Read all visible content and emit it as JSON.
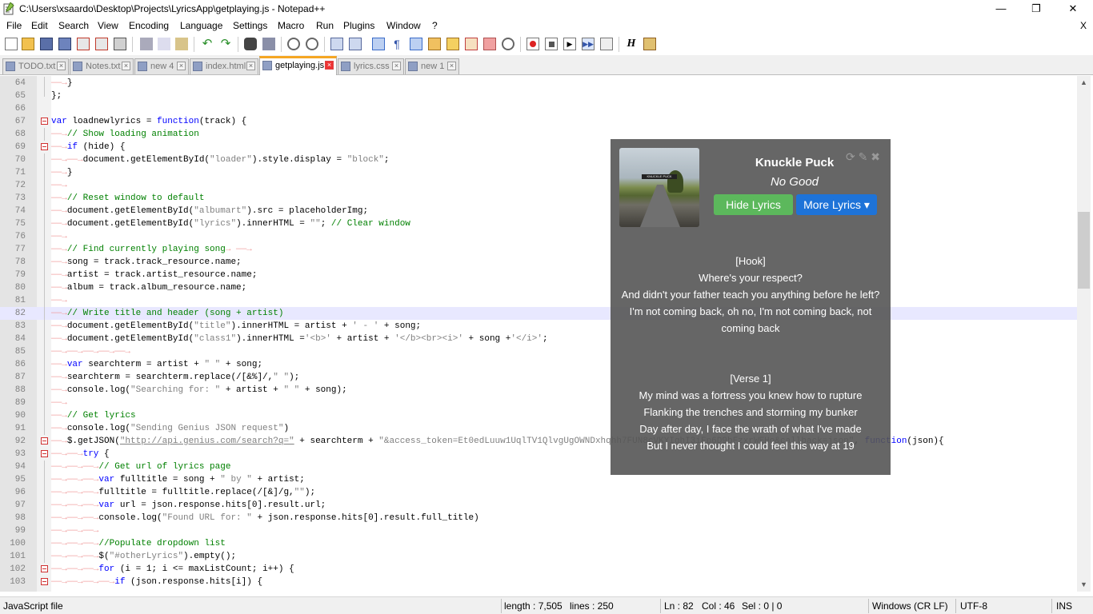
{
  "window": {
    "title": "C:\\Users\\xsaardo\\Desktop\\Projects\\LyricsApp\\getplaying.js - Notepad++",
    "minimize": "—",
    "maximize": "❐",
    "close": "✕"
  },
  "menu": {
    "items": [
      "File",
      "Edit",
      "Search",
      "View",
      "Encoding",
      "Language",
      "Settings",
      "Macro",
      "Run",
      "Plugins",
      "Window",
      "?"
    ],
    "close": "X"
  },
  "tabs": [
    {
      "label": "TODO.txt",
      "active": false
    },
    {
      "label": "Notes.txt",
      "active": false
    },
    {
      "label": "new 4",
      "active": false
    },
    {
      "label": "index.html",
      "active": false
    },
    {
      "label": "getplaying.js",
      "active": true
    },
    {
      "label": "lyrics.css",
      "active": false
    },
    {
      "label": "new 1",
      "active": false
    }
  ],
  "editor": {
    "current_line": 82,
    "lines": [
      {
        "n": "64",
        "fold": "line",
        "html": "<span class=\"ar\">——→</span>}"
      },
      {
        "n": "65",
        "fold": "end",
        "html": "};"
      },
      {
        "n": "66",
        "fold": "",
        "html": ""
      },
      {
        "n": "67",
        "fold": "box",
        "html": "<span class=\"k\">var</span> loadnewlyrics = <span class=\"k\">function</span>(track) {"
      },
      {
        "n": "68",
        "fold": "line",
        "html": "<span class=\"ar\">——→</span><span class=\"c\">// Show loading animation</span>"
      },
      {
        "n": "69",
        "fold": "box",
        "html": "<span class=\"ar\">——→</span><span class=\"k\">if</span> (hide) {"
      },
      {
        "n": "70",
        "fold": "line",
        "html": "<span class=\"ar\">——→——→</span>document.getElementById(<span class=\"s\">\"loader\"</span>).style.display = <span class=\"s\">\"block\"</span>;"
      },
      {
        "n": "71",
        "fold": "line",
        "html": "<span class=\"ar\">——→</span>}"
      },
      {
        "n": "72",
        "fold": "line",
        "html": "<span class=\"ar\">——→</span>"
      },
      {
        "n": "73",
        "fold": "line",
        "html": "<span class=\"ar\">——→</span><span class=\"c\">// Reset window to default</span>"
      },
      {
        "n": "74",
        "fold": "line",
        "html": "<span class=\"ar\">——→</span>document.getElementById(<span class=\"s\">\"albumart\"</span>).src = placeholderImg;"
      },
      {
        "n": "75",
        "fold": "line",
        "html": "<span class=\"ar\">——→</span>document.getElementById(<span class=\"s\">\"lyrics\"</span>).innerHTML = <span class=\"s\">\"\"</span>; <span class=\"c\">// Clear window</span>"
      },
      {
        "n": "76",
        "fold": "line",
        "html": "<span class=\"ar\">——→</span>"
      },
      {
        "n": "77",
        "fold": "line",
        "html": "<span class=\"ar\">——→</span><span class=\"c\">// Find currently playing song</span><span class=\"ar\">→ ——→</span>"
      },
      {
        "n": "78",
        "fold": "line",
        "html": "<span class=\"ar\">——→</span>song = track.track_resource.name;"
      },
      {
        "n": "79",
        "fold": "line",
        "html": "<span class=\"ar\">——→</span>artist = track.artist_resource.name;"
      },
      {
        "n": "80",
        "fold": "line",
        "html": "<span class=\"ar\">——→</span>album = track.album_resource.name;"
      },
      {
        "n": "81",
        "fold": "line",
        "html": "<span class=\"ar\">——→</span>"
      },
      {
        "n": "82",
        "fold": "line",
        "html": "<span class=\"ar\">——→</span><span class=\"c\">// Write title and header (song + artist)</span>"
      },
      {
        "n": "83",
        "fold": "line",
        "html": "<span class=\"ar\">——→</span>document.getElementById(<span class=\"s\">\"title\"</span>).innerHTML = artist + <span class=\"s\">' - '</span> + song;"
      },
      {
        "n": "84",
        "fold": "line",
        "html": "<span class=\"ar\">——→</span>document.getElementById(<span class=\"s\">\"class1\"</span>).innerHTML =<span class=\"s\">'&lt;b&gt;'</span> + artist + <span class=\"s\">'&lt;/b&gt;&lt;br&gt;&lt;i&gt;'</span> + song +<span class=\"s\">'&lt;/i&gt;'</span>;"
      },
      {
        "n": "85",
        "fold": "line",
        "html": "<span class=\"ar\">——→——→——→——→——→</span>"
      },
      {
        "n": "86",
        "fold": "line",
        "html": "<span class=\"ar\">——→</span><span class=\"k\">var</span> searchterm = artist + <span class=\"s\">\" \"</span> + song;"
      },
      {
        "n": "87",
        "fold": "line",
        "html": "<span class=\"ar\">——→</span>searchterm = searchterm.replace(/[&amp;%]/,<span class=\"s\">\" \"</span>);"
      },
      {
        "n": "88",
        "fold": "line",
        "html": "<span class=\"ar\">——→</span>console.log(<span class=\"s\">\"Searching for: \"</span> + artist + <span class=\"s\">\" \"</span> + song);"
      },
      {
        "n": "89",
        "fold": "line",
        "html": "<span class=\"ar\">——→</span>"
      },
      {
        "n": "90",
        "fold": "line",
        "html": "<span class=\"ar\">——→</span><span class=\"c\">// Get lyrics</span>"
      },
      {
        "n": "91",
        "fold": "line",
        "html": "<span class=\"ar\">——→</span>console.log(<span class=\"s\">\"Sending Genius JSON request\"</span>)"
      },
      {
        "n": "92",
        "fold": "box",
        "html": "<span class=\"ar\">——→</span>$.getJSON(<span class=\"s\"><u>\"http://api.genius.com/search?q=\"</u></span> + searchterm + <span class=\"s\">\"&amp;access_token=Et0edLuuw1UqlTV1QlvgUgOWNDxhqhh7FUN8cVKYIghI3iFp6D9bFzxrWEHo&amp;callback=json\"</span>, <span class=\"k\">function</span>(json){"
      },
      {
        "n": "93",
        "fold": "box",
        "html": "<span class=\"ar\">——→——→</span><span class=\"k\">try</span> {"
      },
      {
        "n": "94",
        "fold": "line",
        "html": "<span class=\"ar\">——→——→——→</span><span class=\"c\">// Get url of lyrics page</span>"
      },
      {
        "n": "95",
        "fold": "line",
        "html": "<span class=\"ar\">——→——→——→</span><span class=\"k\">var</span> fulltitle = song + <span class=\"s\">\" by \"</span> + artist;"
      },
      {
        "n": "96",
        "fold": "line",
        "html": "<span class=\"ar\">——→——→——→</span>fulltitle = fulltitle.replace(/[&amp;]/g,<span class=\"s\">\"\"</span>);"
      },
      {
        "n": "97",
        "fold": "line",
        "html": "<span class=\"ar\">——→——→——→</span><span class=\"k\">var</span> url = json.response.hits[0].result.url;"
      },
      {
        "n": "98",
        "fold": "line",
        "html": "<span class=\"ar\">——→——→——→</span>console.log(<span class=\"s\">\"Found URL for: \"</span> + json.response.hits[0].result.full_title)"
      },
      {
        "n": "99",
        "fold": "line",
        "html": "<span class=\"ar\">——→——→——→</span>"
      },
      {
        "n": "100",
        "fold": "line",
        "html": "<span class=\"ar\">——→——→——→</span><span class=\"c\">//Populate dropdown list</span>"
      },
      {
        "n": "101",
        "fold": "line",
        "html": "<span class=\"ar\">——→——→——→</span>$(<span class=\"s\">\"#otherLyrics\"</span>).empty();"
      },
      {
        "n": "102",
        "fold": "box",
        "html": "<span class=\"ar\">——→——→——→</span><span class=\"k\">for</span> (i = 1; i &lt;= maxListCount; i++) {"
      },
      {
        "n": "103",
        "fold": "box",
        "html": "<span class=\"ar\">——→——→——→——→</span><span class=\"k\">if</span> (json.response.hits[i]) {"
      }
    ]
  },
  "overlay": {
    "artist": "Knuckle Puck",
    "song": "No Good",
    "album_text": "KNUCKLE PUCK",
    "hide_button": "Hide Lyrics",
    "more_button": "More Lyrics ▾",
    "icons": [
      "refresh-icon",
      "wrench-icon",
      "close-icon"
    ],
    "lyrics": [
      "[Hook]",
      "Where's your respect?",
      "And didn't your father teach you anything before he left?",
      "I'm not coming back, oh no, I'm not coming back, not coming back",
      "",
      "",
      "[Verse 1]",
      "My mind was a fortress you knew how to rupture",
      "Flanking the trenches and storming my bunker",
      "Day after day, I face the wrath of what I've made",
      "But I never thought I could feel this way at 19"
    ]
  },
  "status": {
    "file_type": "JavaScript file",
    "length": "length : 7,505",
    "lines": "lines : 250",
    "ln": "Ln : 82",
    "col": "Col : 46",
    "sel": "Sel : 0 | 0",
    "eol": "Windows (CR LF)",
    "encoding": "UTF-8",
    "mode": "INS"
  },
  "colors": {
    "active_tab_accent": "#f5a623",
    "hide_button": "#5cb85c",
    "more_button": "#1e73d8",
    "comment": "#008000",
    "keyword": "#0000ff"
  }
}
